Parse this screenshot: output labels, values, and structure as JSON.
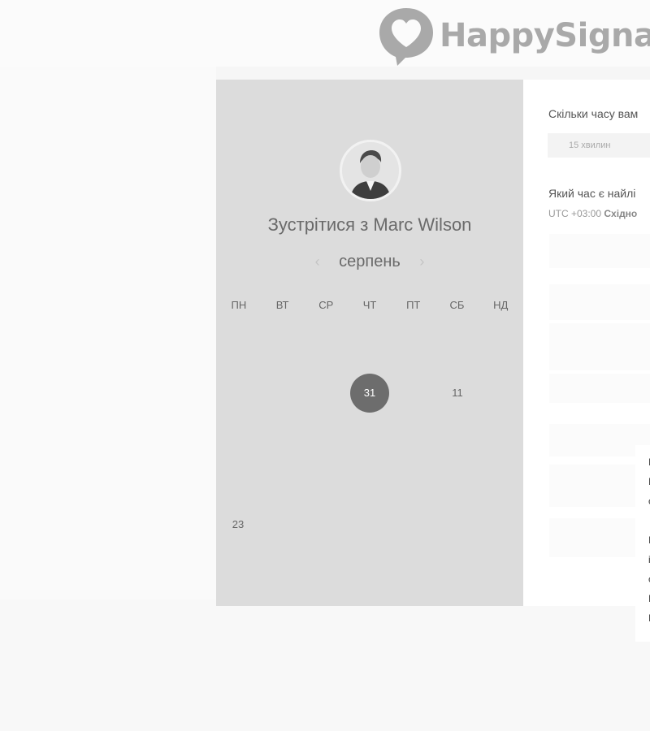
{
  "header": {
    "logo_text": "HappySignal",
    "logo_icon": "heart-chat-bubble-icon"
  },
  "calendar": {
    "title": "Зустрітися з Marc Wilson",
    "month": "серпень",
    "prev_icon": "chevron-left-icon",
    "next_icon": "chevron-right-icon",
    "weekdays": [
      "ПН",
      "ВТ",
      "СР",
      "ЧТ",
      "ПТ",
      "СБ",
      "НД"
    ],
    "weeks": [
      [
        "",
        "",
        "",
        "",
        "",
        "",
        ""
      ],
      [
        "",
        "",
        "",
        "31",
        "",
        "11",
        ""
      ],
      [
        "",
        "",
        "",
        "",
        "",
        "",
        ""
      ],
      [
        "",
        "",
        "",
        "",
        "",
        "",
        ""
      ],
      [
        "23",
        "",
        "",
        "",
        "",
        "",
        ""
      ]
    ],
    "selected_day": "31",
    "active_days": [
      "31",
      "11",
      "23"
    ]
  },
  "booking": {
    "duration_question": "Скільки часу вам",
    "duration_option": "15 хвилин",
    "time_question": "Який час є найлі",
    "timezone_offset": "UTC +03:00",
    "timezone_name": "Східно"
  },
  "colors": {
    "panel_bg": "#dcdcdc",
    "selected_day_bg": "#6d6d6d",
    "logo_color": "#a9a9a9"
  }
}
